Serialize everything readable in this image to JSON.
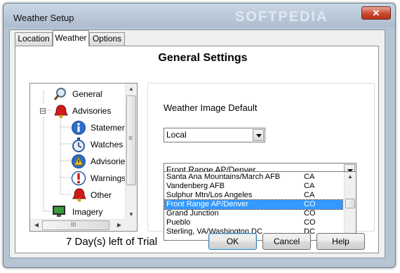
{
  "window": {
    "title": "Weather Setup",
    "watermark": "SOFTPEDIA",
    "close_glyph": "✕"
  },
  "tabs": [
    {
      "label": "Location",
      "active": false
    },
    {
      "label": "Weather",
      "active": true
    },
    {
      "label": "Options",
      "active": false
    }
  ],
  "panel": {
    "heading": "General Settings"
  },
  "tree": {
    "items": [
      {
        "label": "General",
        "icon": "magnifier-icon",
        "expander": ""
      },
      {
        "label": "Advisories",
        "icon": "bell-icon",
        "expander": "⊟"
      },
      {
        "label": "Statemen",
        "icon": "info-icon",
        "expander": ""
      },
      {
        "label": "Watches",
        "icon": "stopwatch-icon",
        "expander": ""
      },
      {
        "label": "Advisories",
        "icon": "warning-triangle-icon",
        "expander": ""
      },
      {
        "label": "Warnings",
        "icon": "exclamation-icon",
        "expander": ""
      },
      {
        "label": "Other",
        "icon": "bell-icon",
        "expander": ""
      },
      {
        "label": "Imagery",
        "icon": "monitor-icon",
        "expander": "⊟"
      }
    ],
    "hscroll_grip": "III",
    "vscroll_grip": "≡"
  },
  "weather_image": {
    "label": "Weather Image Default",
    "type_select": {
      "value": "Local"
    },
    "station_select": {
      "value": "Front Range AP/Denver"
    },
    "stations": [
      {
        "name": "Santa Ana Mountains/March AFB",
        "state": "CA",
        "selected": false
      },
      {
        "name": "Vandenberg AFB",
        "state": "CA",
        "selected": false
      },
      {
        "name": "Sulphur Mtn/Los Angeles",
        "state": "CA",
        "selected": false
      },
      {
        "name": "Front Range AP/Denver",
        "state": "CO",
        "selected": true
      },
      {
        "name": "Grand Junction",
        "state": "CO",
        "selected": false
      },
      {
        "name": "Pueblo",
        "state": "CO",
        "selected": false
      },
      {
        "name": "Sterling, VA/Washington DC",
        "state": "DC",
        "selected": false
      }
    ]
  },
  "footer": {
    "trial_text": "7 Day(s) left of Trial",
    "ok_label": "OK",
    "cancel_label": "Cancel",
    "help_label": "Help"
  },
  "colors": {
    "selection": "#3399ff",
    "frame": "#b7c4d3",
    "close": "#c94a32"
  }
}
